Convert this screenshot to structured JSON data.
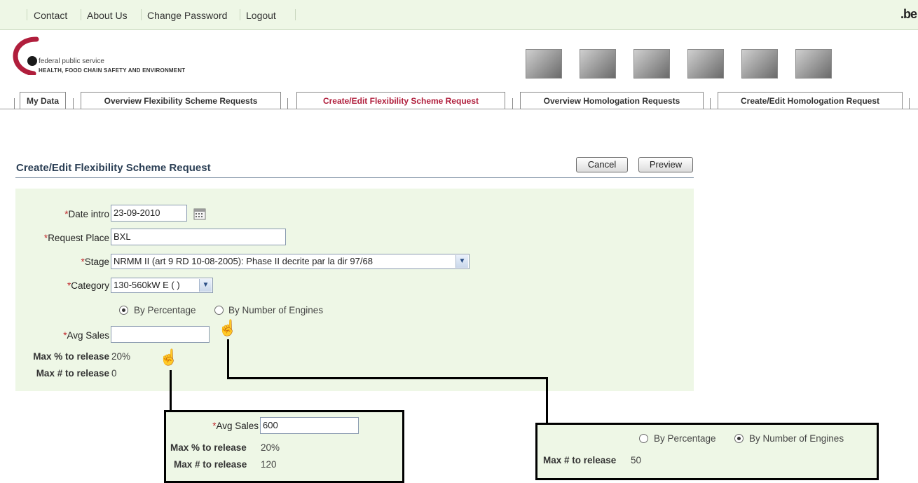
{
  "topnav": {
    "links": [
      "Contact",
      "About Us",
      "Change Password",
      "Logout"
    ],
    "domain": ".be"
  },
  "brand": {
    "line1": "federal public service",
    "line2": "HEALTH, FOOD CHAIN SAFETY AND ENVIRONMENT",
    "color": "#b01e3c"
  },
  "tabs": [
    {
      "label": "My Data",
      "active": false
    },
    {
      "label": "Overview Flexibility Scheme Requests",
      "active": false
    },
    {
      "label": "Create/Edit  Flexibility Scheme Request",
      "active": true
    },
    {
      "label": "Overview  Homologation Requests",
      "active": false
    },
    {
      "label": "Create/Edit  Homologation Request",
      "active": false
    }
  ],
  "page": {
    "title": "Create/Edit Flexibility Scheme Request",
    "cancel_label": "Cancel",
    "preview_label": "Preview"
  },
  "form": {
    "date_intro_label": "Date intro",
    "date_intro_value": "23-09-2010",
    "request_place_label": "Request Place",
    "request_place_value": "BXL",
    "stage_label": "Stage",
    "stage_value": "NRMM II (art 9 RD 10-08-2005): Phase II decrite par la dir 97/68",
    "category_label": "Category",
    "category_value": "130-560kW E ( )",
    "radio_percentage": "By Percentage",
    "radio_engines": "By Number of Engines",
    "selected_mode": "percentage",
    "avg_sales_label": "Avg Sales",
    "avg_sales_value": "",
    "max_pct_label": "Max % to release",
    "max_pct_value": "20%",
    "max_num_label": "Max # to release",
    "max_num_value": "0"
  },
  "callout_avg_sales": {
    "avg_sales_label": "Avg Sales",
    "avg_sales_value": "600",
    "max_pct_label": "Max % to release",
    "max_pct_value": "20%",
    "max_num_label": "Max # to release",
    "max_num_value": "120"
  },
  "callout_engines": {
    "radio_percentage": "By Percentage",
    "radio_engines": "By Number of Engines",
    "selected_mode": "engines",
    "max_num_label": "Max # to release",
    "max_num_value": "50"
  },
  "colors": {
    "panel_bg": "#eef7e6",
    "active_tab": "#b01e3c",
    "required_star": "#c0282c",
    "title": "#2b3f55"
  }
}
